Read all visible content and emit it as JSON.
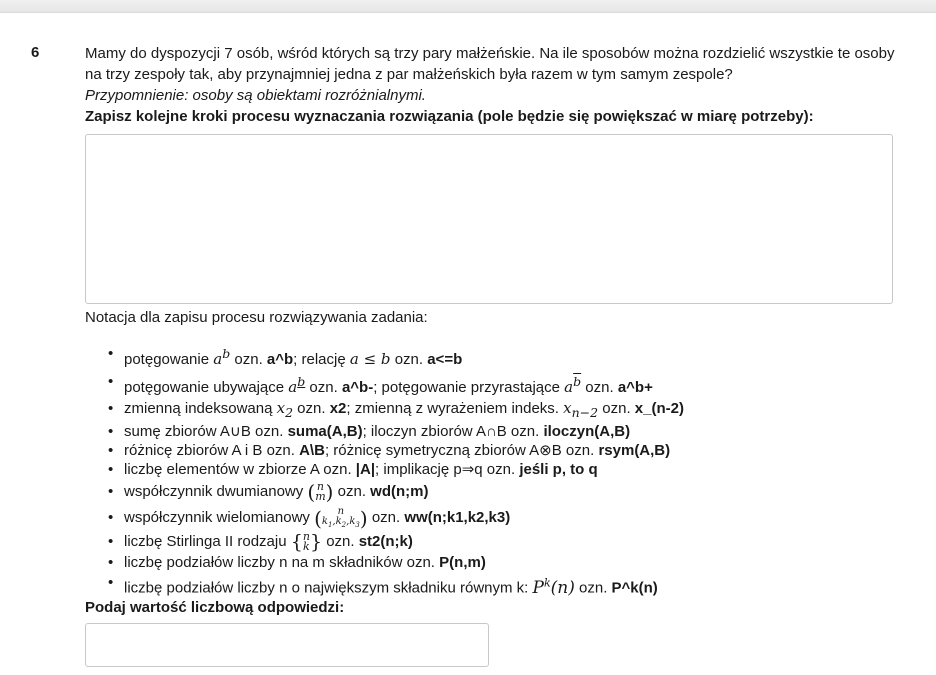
{
  "question": {
    "number": "6",
    "text": "Mamy do dyspozycji 7 osób, wśród których są trzy pary małżeńskie. Na ile sposobów można rozdzielić wszystkie te osoby na trzy zespoły tak, aby przynajmniej jedna z par małżeńskich była razem w tym samym zespole?",
    "reminder": "Przypomnienie: osoby są obiektami rozróżnialnymi.",
    "steps_label": "Zapisz kolejne kroki procesu wyznaczania rozwiązania (pole będzie się powiększać w miarę potrzeby):",
    "steps_value": ""
  },
  "notation": {
    "title": "Notacja dla zapisu procesu rozwiązywania zadania:",
    "bullet": "•",
    "items": [
      {
        "a": "potęgowanie ",
        "m1": "a^b",
        "b": " ozn. ",
        "c1": "a^b",
        "d": ";   relację ",
        "m2": "a ≤ b",
        "e": " ozn. ",
        "c2": "a<=b"
      },
      {
        "a": "potęgowanie ubywające ",
        "m1": "a^b̲",
        "b": " ozn. ",
        "c1": "a^b-",
        "d": ";   potęgowanie przyrastające ",
        "m2": "a^b̄",
        "e": " ozn. ",
        "c2": "a^b+"
      },
      {
        "a": "zmienną indeksowaną ",
        "m1": "x₂",
        "b": " ozn. ",
        "c1": "x2",
        "d": ";  zmienną z wyrażeniem indeks. ",
        "m2": "xₙ₋₂",
        "e": " ozn. ",
        "c2": "x_(n-2)"
      },
      {
        "a": "sumę zbiorów A∪B ozn. ",
        "c1": "suma(A,B)",
        "d": ";   iloczyn zbiorów A∩B ozn. ",
        "c2": "iloczyn(A,B)"
      },
      {
        "a": "różnicę zbiorów A i B ozn. ",
        "c1": "A\\B",
        "d": ";   różnicę symetryczną zbiorów A⊗B ozn. ",
        "c2": "rsym(A,B)"
      },
      {
        "a": "liczbę elementów w zbiorze A ozn. ",
        "c1": "|A|",
        "d": ";   implikację p⇒q ozn. ",
        "c2": "jeśli p, to q"
      },
      {
        "a": "współczynnik dwumianowy ",
        "m1": "(n m)",
        "b": " ozn. ",
        "c1": "wd(n;m)"
      },
      {
        "a": "współczynnik wielomianowy ",
        "m1": "(n k₁,k₂,k₃)",
        "b": " ozn. ",
        "c1": "ww(n;k1,k2,k3)"
      },
      {
        "a": "liczbę Stirlinga II rodzaju ",
        "m1": "{n k}",
        "b": " ozn. ",
        "c1": "st2(n;k)"
      },
      {
        "a": "liczbę podziałów liczby n na m składników ozn. ",
        "c1": "P(n,m)"
      },
      {
        "a": "liczbę podziałów liczby n o największym składniku równym k: ",
        "m1": "P^k(n)",
        "b": " ozn. ",
        "c1": "P^k(n)"
      }
    ]
  },
  "answer": {
    "label": "Podaj wartość liczbową odpowiedzi:",
    "value": ""
  }
}
